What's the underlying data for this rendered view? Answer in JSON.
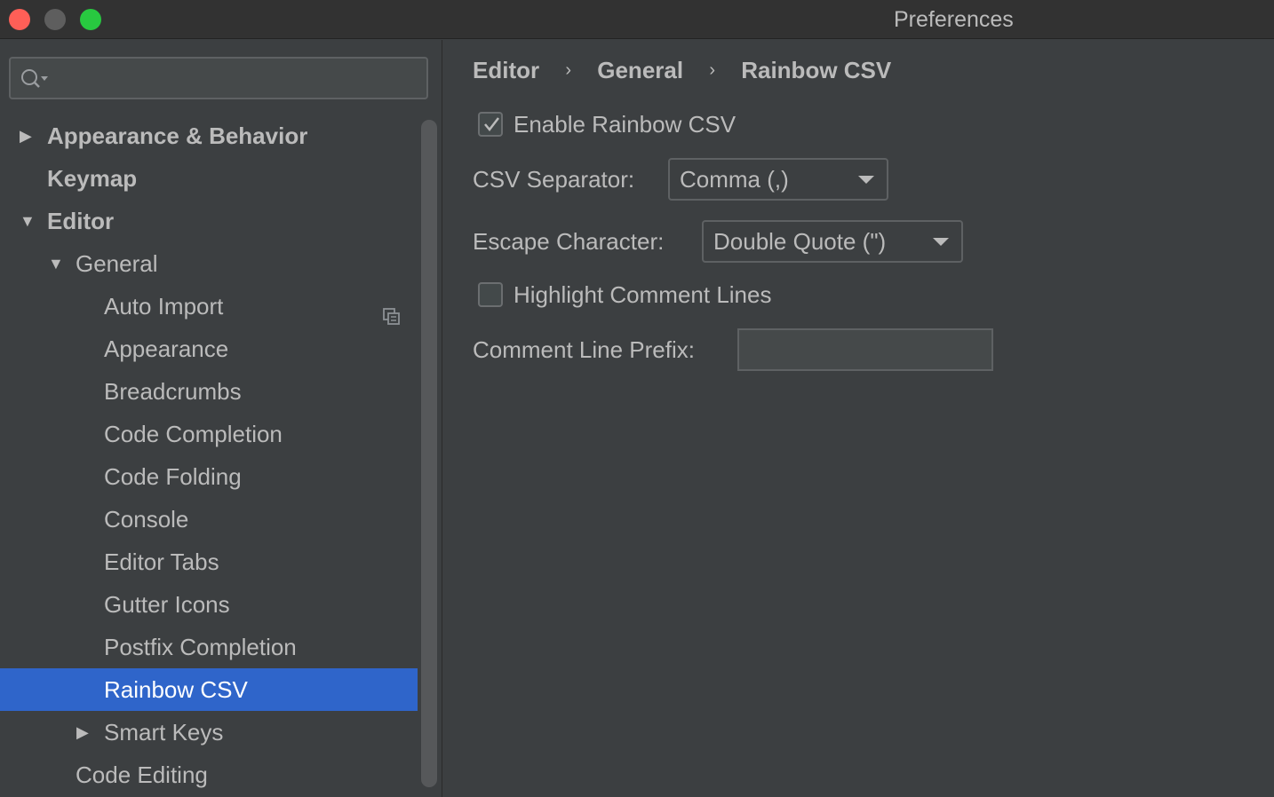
{
  "window": {
    "title": "Preferences"
  },
  "sidebar": {
    "search": {
      "value": "",
      "placeholder": ""
    },
    "items": [
      {
        "label": "Appearance & Behavior",
        "expanded": false
      },
      {
        "label": "Keymap"
      },
      {
        "label": "Editor",
        "expanded": true
      },
      {
        "label": "General",
        "expanded": true
      },
      {
        "label": "Auto Import"
      },
      {
        "label": "Appearance"
      },
      {
        "label": "Breadcrumbs"
      },
      {
        "label": "Code Completion"
      },
      {
        "label": "Code Folding"
      },
      {
        "label": "Console"
      },
      {
        "label": "Editor Tabs"
      },
      {
        "label": "Gutter Icons"
      },
      {
        "label": "Postfix Completion"
      },
      {
        "label": "Rainbow CSV",
        "selected": true
      },
      {
        "label": "Smart Keys",
        "expanded": false
      },
      {
        "label": "Code Editing"
      }
    ]
  },
  "breadcrumb": {
    "items": [
      "Editor",
      "General",
      "Rainbow CSV"
    ],
    "separator": "›"
  },
  "settings": {
    "enable": {
      "label": "Enable Rainbow CSV",
      "checked": true
    },
    "separator": {
      "label": "CSV Separator:",
      "value": "Comma (,)"
    },
    "escape": {
      "label": "Escape Character:",
      "value": "Double Quote (\")"
    },
    "highlight": {
      "label": "Highlight Comment Lines",
      "checked": false
    },
    "prefix": {
      "label": "Comment Line Prefix:",
      "value": ""
    }
  },
  "colors": {
    "selection": "#2f65ca",
    "background": "#3c3f41"
  }
}
